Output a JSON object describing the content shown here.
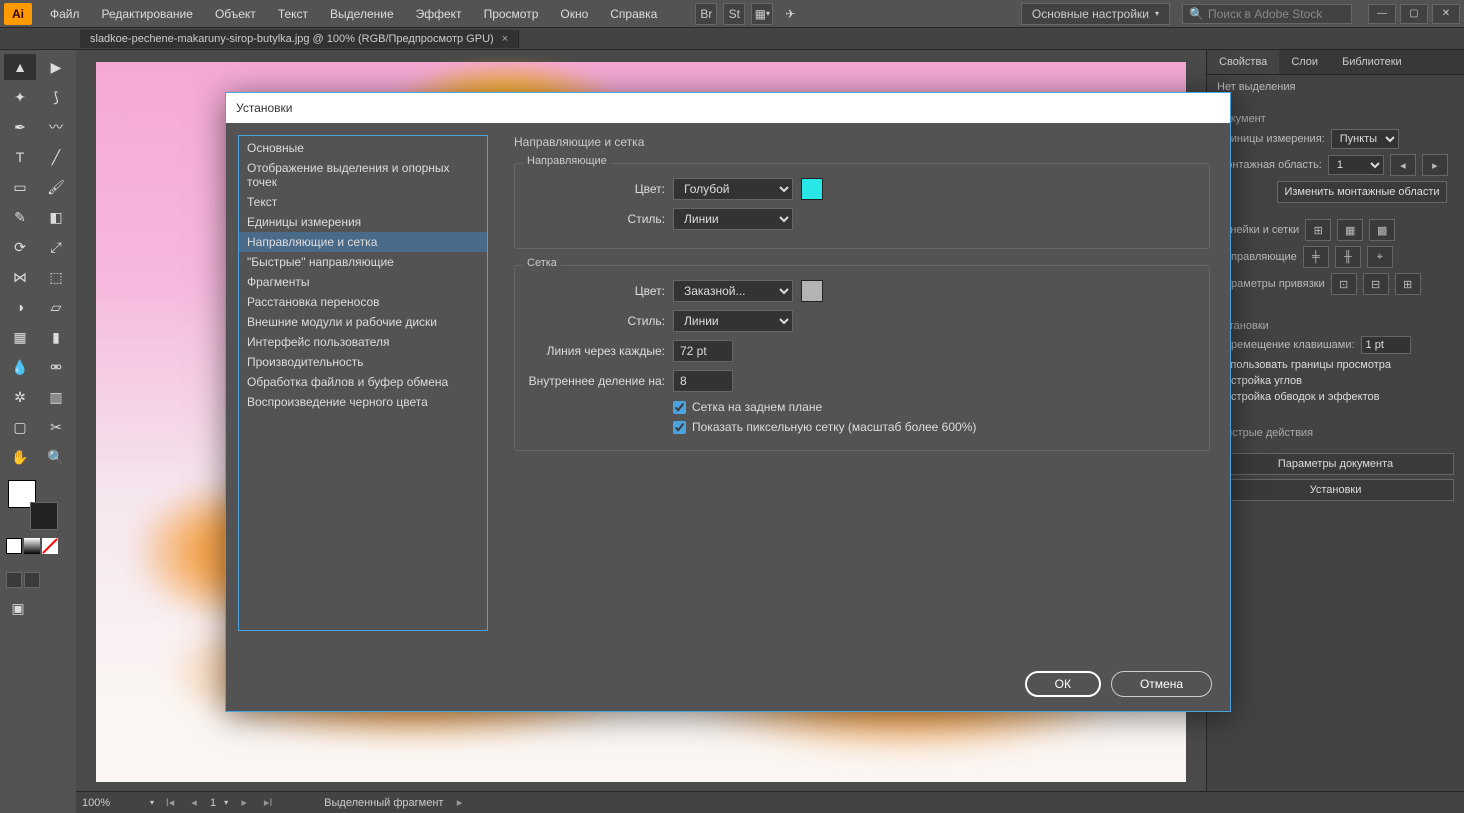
{
  "app_logo": "Ai",
  "menu": [
    "Файл",
    "Редактирование",
    "Объект",
    "Текст",
    "Выделение",
    "Эффект",
    "Просмотр",
    "Окно",
    "Справка"
  ],
  "workspace_label": "Основные настройки",
  "search_placeholder": "Поиск в Adobe Stock",
  "doc_tab": "sladkoe-pechene-makaruny-sirop-butylka.jpg @ 100% (RGB/Предпросмотр GPU)",
  "right": {
    "tabs": [
      "Свойства",
      "Слои",
      "Библиотеки"
    ],
    "no_selection": "Нет выделения",
    "doc_hdr": "Документ",
    "units_label": "Единицы измерения:",
    "units_value": "Пункты",
    "artboard_label": "Монтажная область:",
    "artboard_value": "1",
    "edit_artboards": "Изменить монтажные области",
    "rulers_grid": "Линейки и сетки",
    "guides": "Направляющие",
    "snap": "Параметры привязки",
    "prefs_hdr": "Установки",
    "key_increment_label": "Перемещение клавишами:",
    "key_increment_value": "1 pt",
    "use_preview_bounds": "Использовать границы просмотра",
    "corners": "Настройка углов",
    "stroke_effects": "Настройка обводок и эффектов",
    "quick_actions": "Быстрые действия",
    "doc_setup": "Параметры документа",
    "preferences": "Установки"
  },
  "status": {
    "zoom": "100%",
    "artboard": "1",
    "sel": "Выделенный фрагмент"
  },
  "dialog": {
    "title": "Установки",
    "categories": [
      "Основные",
      "Отображение выделения и опорных точек",
      "Текст",
      "Единицы измерения",
      "Направляющие и сетка",
      "\"Быстрые\" направляющие",
      "Фрагменты",
      "Расстановка переносов",
      "Внешние модули и рабочие диски",
      "Интерфейс пользователя",
      "Производительность",
      "Обработка файлов и буфер обмена",
      "Воспроизведение черного цвета"
    ],
    "selected_category_index": 4,
    "page_title": "Направляющие и сетка",
    "guides_group": "Направляющие",
    "grid_group": "Сетка",
    "color_label": "Цвет:",
    "style_label": "Стиль:",
    "guides_color": "Голубой",
    "guides_color_hex": "#29E7E7",
    "guides_style": "Линии",
    "grid_color": "Заказной...",
    "grid_color_hex": "#b3b3b3",
    "grid_style": "Линии",
    "gridline_every_label": "Линия через каждые:",
    "gridline_every_value": "72 pt",
    "subdiv_label": "Внутреннее деление на:",
    "subdiv_value": "8",
    "grid_back": "Сетка на заднем плане",
    "pixel_grid": "Показать пиксельную сетку (масштаб более 600%)",
    "ok": "ОК",
    "cancel": "Отмена"
  }
}
